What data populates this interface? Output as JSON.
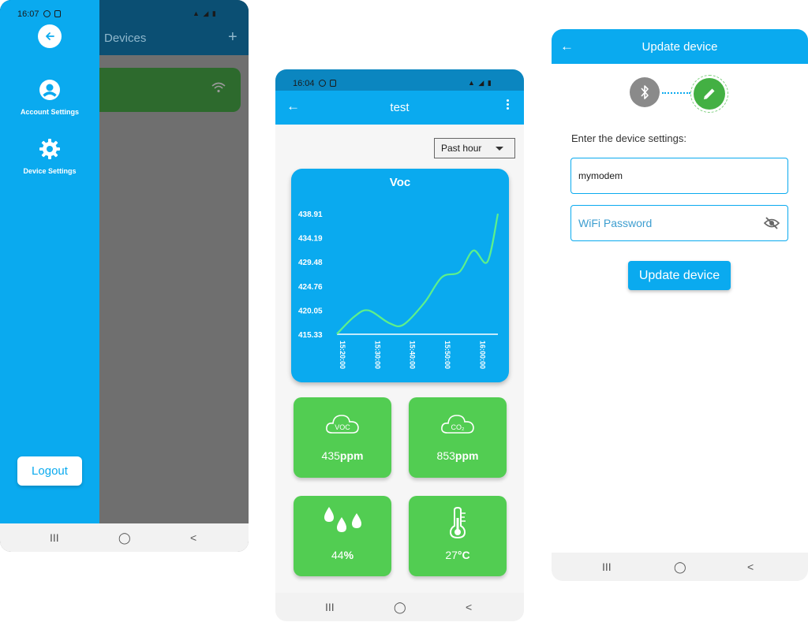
{
  "phone1": {
    "status": {
      "time": "16:07",
      "right": "▲ ◢ ▮"
    },
    "appbar": {
      "title": "Devices",
      "add_label": "+"
    },
    "drawer": {
      "items": [
        {
          "label": "Account Settings",
          "icon": "account-circle-icon"
        },
        {
          "label": "Device Settings",
          "icon": "gear-icon"
        }
      ],
      "logout_label": "Logout"
    },
    "nav": {
      "recents": "III",
      "home": "◯",
      "back": "<"
    }
  },
  "phone2": {
    "status": {
      "time": "16:04",
      "right": "▲ ◢ ▮"
    },
    "appbar": {
      "title": "test",
      "back": "←"
    },
    "range_select": {
      "selected": "Past hour"
    },
    "chart_data": {
      "type": "line",
      "title": "Voc",
      "yticks": [
        "438.91",
        "434.19",
        "429.48",
        "424.76",
        "420.05",
        "415.33"
      ],
      "xticks": [
        "15:20:00",
        "15:30:00",
        "15:40:00",
        "15:50:00",
        "16:00:00"
      ],
      "ylim": [
        415.33,
        438.91
      ],
      "x": [
        "15:20",
        "15:25",
        "15:29",
        "15:35",
        "15:39",
        "15:45",
        "15:50",
        "15:55",
        "15:59",
        "16:03",
        "16:06"
      ],
      "values": [
        415.4,
        418.8,
        420.0,
        417.5,
        417.2,
        421.5,
        426.5,
        427.5,
        431.7,
        429.5,
        438.9
      ],
      "grid": false
    },
    "tiles": [
      {
        "icon": "voc-cloud-icon",
        "icon_text": "VOC",
        "value": "435",
        "unit": "ppm"
      },
      {
        "icon": "co2-cloud-icon",
        "icon_text": "CO₂",
        "value": "853",
        "unit": "ppm"
      },
      {
        "icon": "humidity-drops-icon",
        "value": "44",
        "unit": "%"
      },
      {
        "icon": "thermometer-icon",
        "value": "27",
        "unit": "°C"
      }
    ],
    "nav": {
      "recents": "III",
      "home": "◯",
      "back": "<"
    }
  },
  "phone3": {
    "appbar": {
      "title": "Update device",
      "back": "←"
    },
    "prompt": "Enter the device settings:",
    "ssid_value": "mymodem",
    "password_placeholder": "WiFi Password",
    "update_label": "Update device",
    "colors": {
      "primary": "#0aaaef",
      "success": "#52cd52"
    },
    "nav": {
      "recents": "III",
      "home": "◯",
      "back": "<"
    }
  }
}
